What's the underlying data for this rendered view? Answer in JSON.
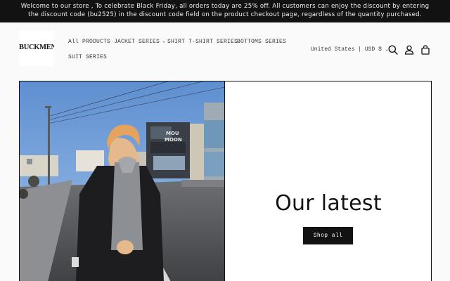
{
  "announcement": "Welcome to our store , To celebrate Black Friday, all orders today are 25% off. All customers can enjoy the discount by entering the discount code (bu2525) in the discount code field on the product checkout page, regardless of the quantity purchased.",
  "logo": {
    "text": "BUCKMEN"
  },
  "nav": {
    "items": [
      {
        "label": "All PRODUCTS",
        "dropdown": false
      },
      {
        "label": "JACKET SERIES",
        "dropdown": true
      },
      {
        "label": "SHIRT T-SHIRT SERIES",
        "dropdown": false
      },
      {
        "label": "BOTTOMS SERIES",
        "dropdown": false
      },
      {
        "label": "SUIT SERIES",
        "dropdown": false
      }
    ]
  },
  "header_tools": {
    "locale": "United States | USD $",
    "icons": [
      "search-icon",
      "account-icon",
      "cart-icon"
    ]
  },
  "hero": {
    "heading": "Our latest",
    "button_label": "Shop all",
    "storefront_sign": "MOU MOON"
  },
  "colors": {
    "dark": "#121212",
    "page_bg": "#fafafa",
    "sky": "#7aa4d6"
  }
}
